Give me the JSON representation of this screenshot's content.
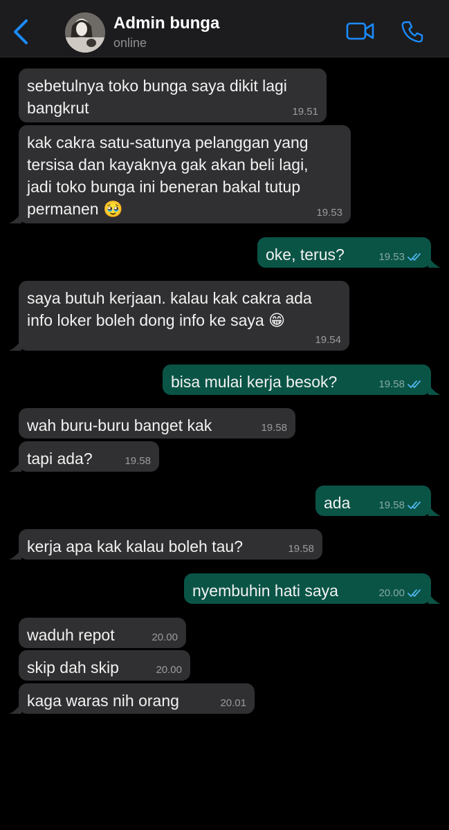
{
  "header": {
    "contact_name": "Admin bunga",
    "status": "online"
  },
  "colors": {
    "accent": "#1a8cff",
    "incoming_bubble": "#303032",
    "outgoing_bubble": "#0a5446",
    "read_ticks": "#4fb6ec"
  },
  "messages": [
    {
      "dir": "in",
      "text": "sebetulnya toko bunga saya dikit lagi\nbangkrut",
      "time": "19.51"
    },
    {
      "dir": "in",
      "text": "kak cakra satu-satunya pelanggan yang\ntersisa dan kayaknya gak akan beli lagi,\njadi toko bunga ini beneran bakal tutup\npermanen 🥹",
      "time": "19.53"
    },
    {
      "dir": "out",
      "text": "oke, terus?",
      "time": "19.53"
    },
    {
      "dir": "in",
      "text": "saya butuh kerjaan. kalau kak cakra ada\ninfo loker boleh dong info ke saya 😁",
      "time": "19.54"
    },
    {
      "dir": "out",
      "text": "bisa mulai kerja besok?",
      "time": "19.58"
    },
    {
      "dir": "in",
      "text": "wah buru-buru banget kak",
      "time": "19.58"
    },
    {
      "dir": "in",
      "text": "tapi ada?",
      "time": "19.58"
    },
    {
      "dir": "out",
      "text": "ada",
      "time": "19.58"
    },
    {
      "dir": "in",
      "text": "kerja apa kak kalau boleh tau?",
      "time": "19.58"
    },
    {
      "dir": "out",
      "text": "nyembuhin hati saya",
      "time": "20.00"
    },
    {
      "dir": "in",
      "text": "waduh repot",
      "time": "20.00"
    },
    {
      "dir": "in",
      "text": "skip dah skip",
      "time": "20.00"
    },
    {
      "dir": "in",
      "text": "kaga waras nih orang",
      "time": "20.01"
    }
  ]
}
